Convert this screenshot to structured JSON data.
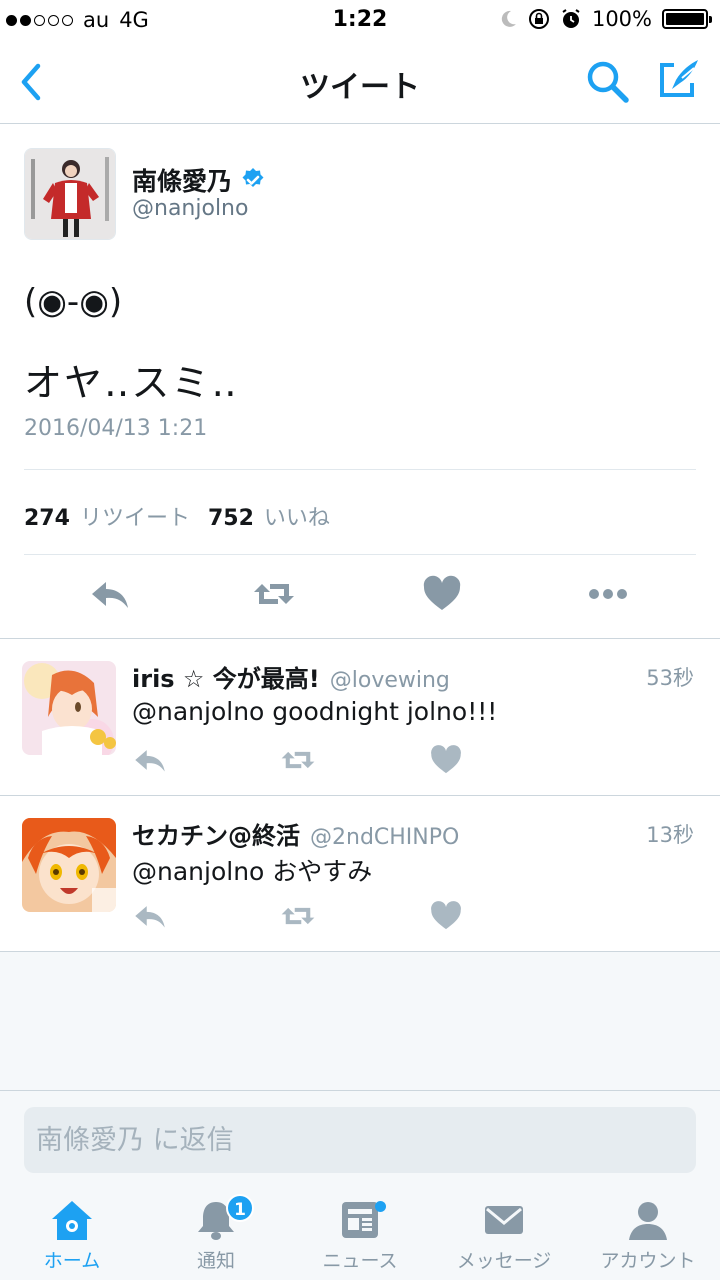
{
  "status_bar": {
    "carrier": "au",
    "network": "4G",
    "time": "1:22",
    "battery": "100%"
  },
  "nav": {
    "title": "ツイート"
  },
  "tweet": {
    "author_name": "南條愛乃",
    "verified": true,
    "author_handle": "@nanjolno",
    "text_line1": "(◉-◉)",
    "text_line2": "オヤ‥スミ‥",
    "timestamp": "2016/04/13 1:21",
    "retweet_count": "274",
    "retweet_label": "リツイート",
    "like_count": "752",
    "like_label": "いいね"
  },
  "replies": [
    {
      "name": "iris ☆ 今が最高!",
      "handle": "@lovewing",
      "time": "53秒",
      "text": "@nanjolno goodnight jolno!!!"
    },
    {
      "name": "セカチン@終活",
      "handle": "@2ndCHINPO",
      "time": "13秒",
      "text": "@nanjolno おやすみ"
    }
  ],
  "reply_bar": {
    "placeholder": "南條愛乃 に返信"
  },
  "tabs": [
    {
      "label": "ホーム",
      "active": true
    },
    {
      "label": "通知",
      "badge": "1"
    },
    {
      "label": "ニュース"
    },
    {
      "label": "メッセージ"
    },
    {
      "label": "アカウント"
    }
  ],
  "colors": {
    "accent": "#1da1f2",
    "icon_gray": "#8899a6",
    "text": "#14171a"
  }
}
